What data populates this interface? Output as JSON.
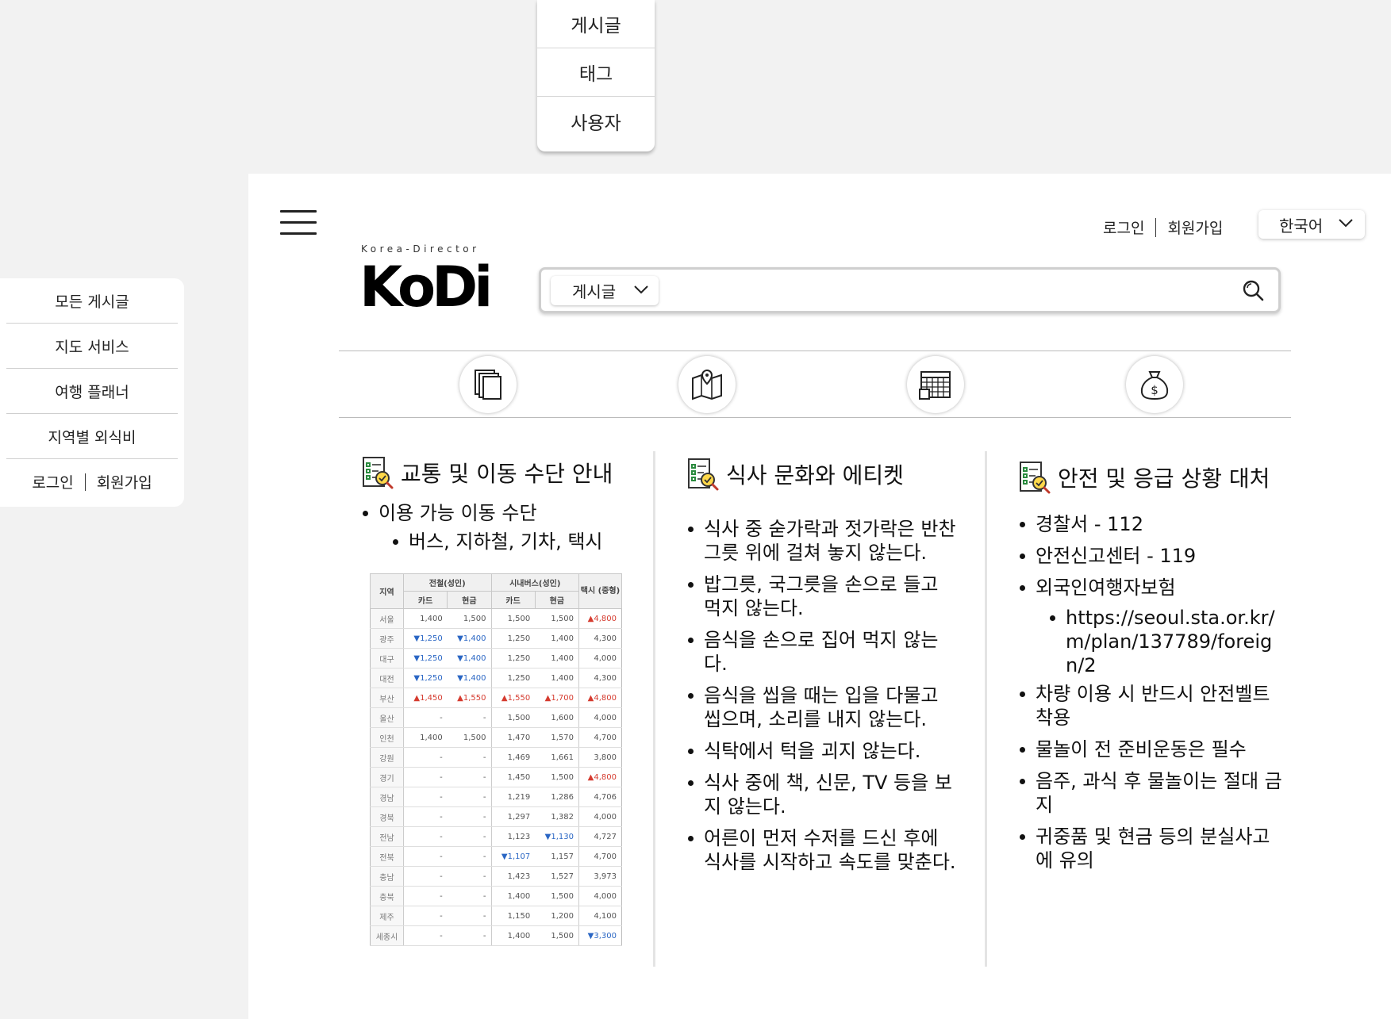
{
  "top_dropdown": {
    "items": [
      "게시글",
      "태그",
      "사용자"
    ]
  },
  "side_menu": {
    "items": [
      "모든 게시글",
      "지도 서비스",
      "여행 플래너",
      "지역별 외식비"
    ],
    "login": "로그인",
    "signup": "회원가입"
  },
  "header": {
    "login": "로그인",
    "signup": "회원가입",
    "language": "한국어"
  },
  "logo": {
    "tagline": "Korea-Director",
    "wordmark": "KoDi"
  },
  "search": {
    "type": "게시글",
    "placeholder": ""
  },
  "categories": [
    "documents-icon",
    "map-icon",
    "calendar-icon",
    "money-bag-icon"
  ],
  "sections": {
    "transport": {
      "title": "교통 및 이동 수단 안내",
      "item": "이용 가능 이동 수단",
      "subitem": "버스, 지하철, 기차, 택시",
      "table": {
        "headers": {
          "region": "지역",
          "subway": "전철(성인)",
          "bus": "시내버스(성인)",
          "taxi": "택시 (중형)",
          "card": "카드",
          "cash": "현금"
        },
        "rows": [
          [
            "서울",
            "1,400",
            "1,500",
            "1,500",
            "1,500",
            "▲4,800"
          ],
          [
            "광주",
            "▼1,250",
            "▼1,400",
            "1,250",
            "1,400",
            "4,300"
          ],
          [
            "대구",
            "▼1,250",
            "▼1,400",
            "1,250",
            "1,400",
            "4,000"
          ],
          [
            "대전",
            "▼1,250",
            "▼1,400",
            "1,250",
            "1,400",
            "4,300"
          ],
          [
            "부산",
            "▲1,450",
            "▲1,550",
            "▲1,550",
            "▲1,700",
            "▲4,800"
          ],
          [
            "울산",
            "-",
            "-",
            "1,500",
            "1,600",
            "4,000"
          ],
          [
            "인천",
            "1,400",
            "1,500",
            "1,470",
            "1,570",
            "4,700"
          ],
          [
            "강원",
            "-",
            "-",
            "1,469",
            "1,661",
            "3,800"
          ],
          [
            "경기",
            "-",
            "-",
            "1,450",
            "1,500",
            "▲4,800"
          ],
          [
            "경남",
            "-",
            "-",
            "1,219",
            "1,286",
            "4,706"
          ],
          [
            "경북",
            "-",
            "-",
            "1,297",
            "1,382",
            "4,000"
          ],
          [
            "전남",
            "-",
            "-",
            "1,123",
            "▼1,130",
            "4,727"
          ],
          [
            "전북",
            "-",
            "-",
            "▼1,107",
            "1,157",
            "4,700"
          ],
          [
            "충남",
            "-",
            "-",
            "1,423",
            "1,527",
            "3,973"
          ],
          [
            "충북",
            "-",
            "-",
            "1,400",
            "1,500",
            "4,000"
          ],
          [
            "제주",
            "-",
            "-",
            "1,150",
            "1,200",
            "4,100"
          ],
          [
            "세종시",
            "-",
            "-",
            "1,400",
            "1,500",
            "▼3,300"
          ]
        ]
      }
    },
    "dining": {
      "title": "식사 문화와 에티켓",
      "items": [
        "식사 중 숟가락과 젓가락은 반찬 그릇 위에 걸쳐 놓지 않는다.",
        "밥그릇, 국그릇을 손으로 들고 먹지 않는다.",
        "음식을 손으로 집어 먹지 않는다.",
        "음식을 씹을 때는 입을 다물고 씹으며, 소리를 내지 않는다.",
        "식탁에서 턱을 괴지 않는다.",
        "식사 중에 책, 신문, TV 등을 보지 않는다.",
        "어른이 먼저 수저를 드신 후에 식사를 시작하고 속도를 맞춘다."
      ]
    },
    "safety": {
      "title": "안전 및 응급 상황 대처",
      "items": [
        "경찰서 - 112",
        "안전신고센터 - 119",
        "외국인여행자보험"
      ],
      "link": "https://seoul.sta.or.kr/m/plan/137789/foreign/2",
      "items2": [
        "차량 이용 시 반드시 안전벨트 착용",
        "물놀이 전 준비운동은 필수",
        "음주, 과식 후 물놀이는 절대 금지",
        "귀중품 및 현금 등의 분실사고에 유의"
      ]
    }
  },
  "colors": {
    "up": "#d53b2f",
    "down": "#2a66c4",
    "background": "#f2f2f2",
    "panel": "#ffffff"
  }
}
